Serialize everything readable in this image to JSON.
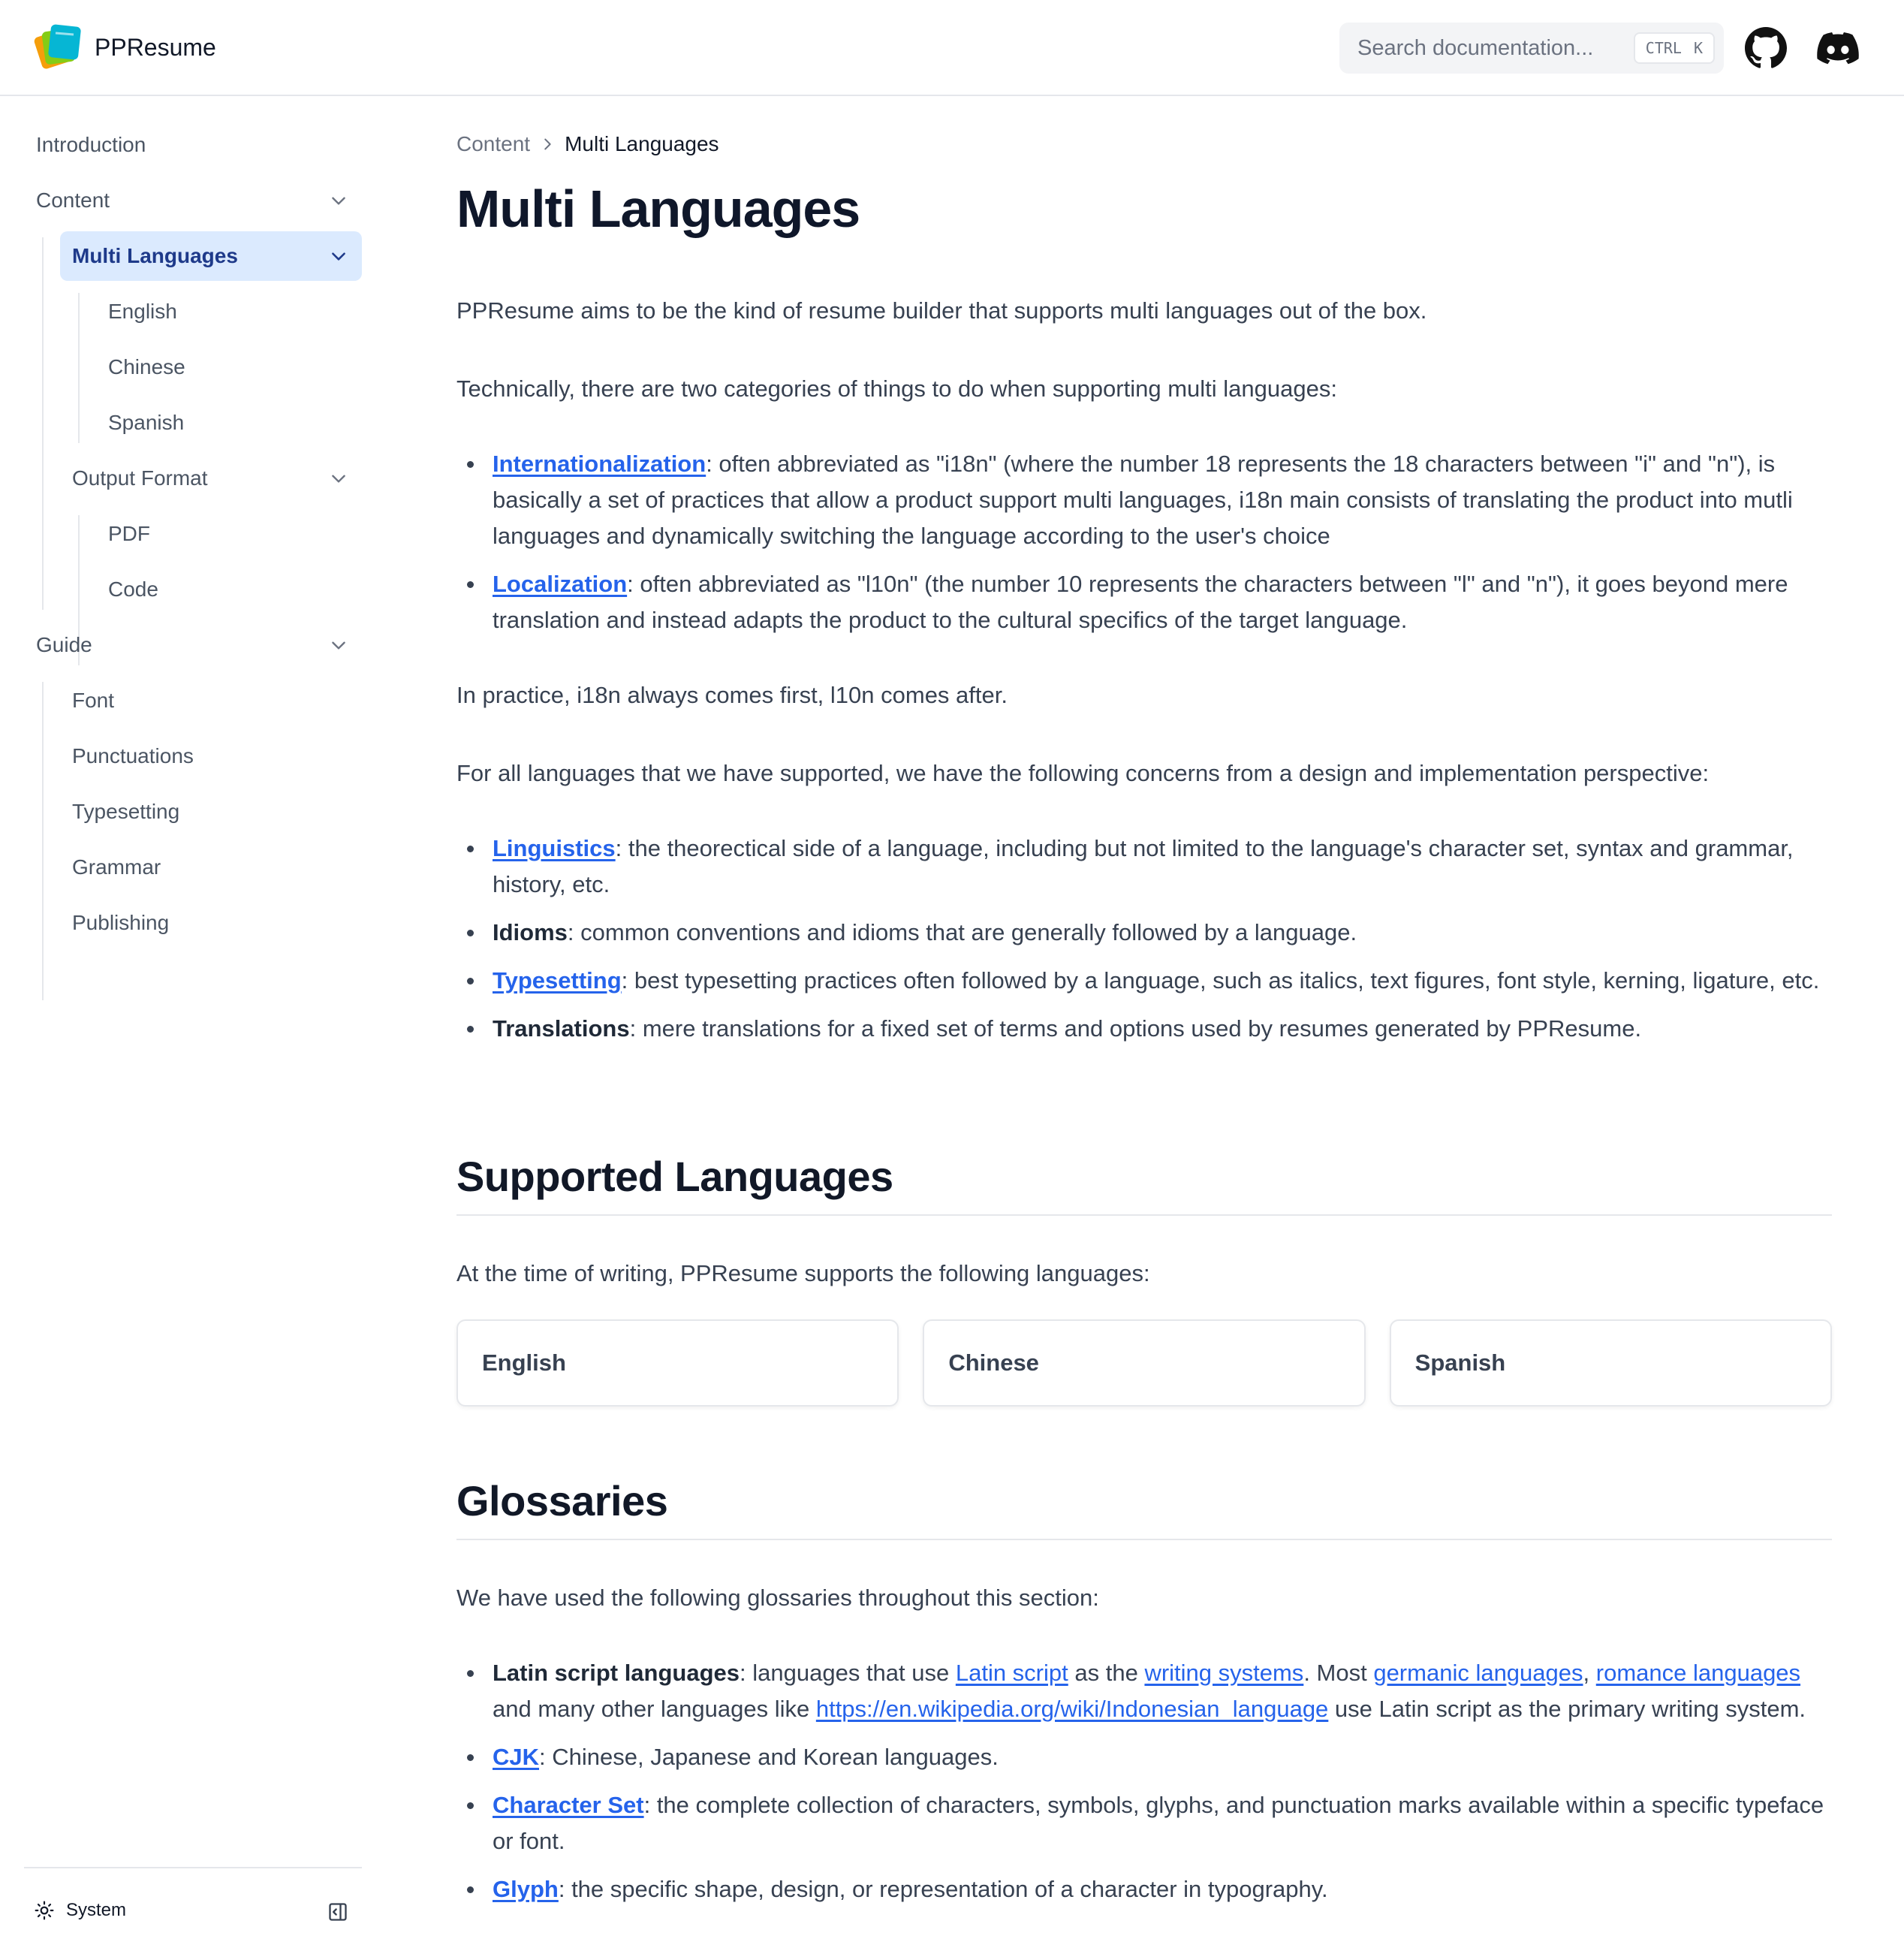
{
  "header": {
    "app_name": "PPResume",
    "search_placeholder": "Search documentation...",
    "shortcut_ctrl": "CTRL",
    "shortcut_key": "K"
  },
  "sidebar": {
    "items": [
      {
        "label": "Introduction"
      },
      {
        "label": "Content"
      },
      {
        "label": "Multi Languages"
      },
      {
        "label": "English"
      },
      {
        "label": "Chinese"
      },
      {
        "label": "Spanish"
      },
      {
        "label": "Output Format"
      },
      {
        "label": "PDF"
      },
      {
        "label": "Code"
      },
      {
        "label": "Guide"
      },
      {
        "label": "Font"
      },
      {
        "label": "Punctuations"
      },
      {
        "label": "Typesetting"
      },
      {
        "label": "Grammar"
      },
      {
        "label": "Publishing"
      }
    ],
    "theme_label": "System"
  },
  "breadcrumb": [
    "Content",
    "Multi Languages"
  ],
  "page": {
    "title": "Multi Languages",
    "intro": "PPResume aims to be the kind of resume builder that supports multi languages out of the box.",
    "categories_intro": "Technically, there are two categories of things to do when supporting multi languages:",
    "categories": [
      {
        "term": "Internationalization",
        "text": ": often abbreviated as \"i18n\" (where the number 18 represents the 18 characters between \"i\" and \"n\"), is basically a set of practices that allow a product support multi languages, i18n main consists of translating the product into mutli languages and dynamically switching the language according to the user's choice"
      },
      {
        "term": "Localization",
        "text": ": often abbreviated as \"l10n\" (the number 10 represents the characters between \"l\" and \"n\"), it goes beyond mere translation and instead adapts the product to the cultural specifics of the target language."
      }
    ],
    "practice": "In practice, i18n always comes first, l10n comes after.",
    "concerns_intro": "For all languages that we have supported, we have the following concerns from a design and implementation perspective:",
    "concerns": [
      {
        "term": "Linguistics",
        "text": ": the theorectical side of a language, including but not limited to the language's character set, syntax and grammar, history, etc."
      },
      {
        "term": "Idioms",
        "text": ": common conventions and idioms that are generally followed by a language."
      },
      {
        "term": "Typesetting",
        "text": ": best typesetting practices often followed by a language, such as italics, text figures, font style, kerning, ligature, etc."
      },
      {
        "term": "Translations",
        "text": ": mere translations for a fixed set of terms and options used by resumes generated by PPResume."
      }
    ],
    "supported_heading": "Supported Languages",
    "supported_intro": "At the time of writing, PPResume supports the following languages:",
    "language_cards": [
      "English",
      "Chinese",
      "Spanish"
    ],
    "glossaries_heading": "Glossaries",
    "glossaries_intro": "We have used the following glossaries throughout this section:",
    "glossary_latin": {
      "term": "Latin script languages",
      "t1": ": languages that use ",
      "l1": "Latin script",
      "t2": " as the ",
      "l2": "writing systems",
      "t3": ". Most ",
      "l3": "germanic languages",
      "t4": ", ",
      "l4": "romance languages",
      "t5": " and many other languages like ",
      "l5": "https://en.wikipedia.org/wiki/Indonesian_language",
      "t6": " use Latin script as the primary writing system."
    },
    "glossaries": [
      {
        "term": "CJK",
        "text": ": Chinese, Japanese and Korean languages."
      },
      {
        "term": "Character Set",
        "text": ": the complete collection of characters, symbols, glyphs, and punctuation marks available within a specific typeface or font."
      },
      {
        "term": "Glyph",
        "text": ": the specific shape, design, or representation of a character in typography."
      }
    ]
  },
  "colors": {
    "accent": "#2563eb",
    "active_bg": "#dbeafe",
    "active_text": "#1e3a8a",
    "heading": "#0f172a"
  }
}
